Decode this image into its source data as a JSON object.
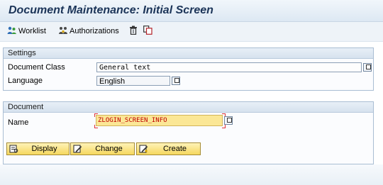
{
  "window": {
    "title": "Document Maintenance: Initial Screen"
  },
  "toolbar": {
    "worklist_label": "Worklist",
    "authorizations_label": "Authorizations"
  },
  "settings": {
    "header": "Settings",
    "document_class_label": "Document Class",
    "document_class_value": "General text",
    "language_label": "Language",
    "language_value": "English"
  },
  "document": {
    "header": "Document",
    "name_label": "Name",
    "name_value": "ZLOGIN_SCREEN_INFO"
  },
  "actions": {
    "display_label": "Display",
    "change_label": "Change",
    "create_label": "Create"
  },
  "colors": {
    "title_text": "#1b3458",
    "input_required": "#fbe796",
    "button_fill": "#f5d75e",
    "group_border": "#a9bdd3"
  },
  "icons": {
    "worklist": "worklist-icon",
    "authorizations": "authorizations-icon",
    "delete": "trash-icon",
    "copy": "copy-icon",
    "display": "display-icon",
    "change": "pencil-icon",
    "create": "create-icon"
  }
}
